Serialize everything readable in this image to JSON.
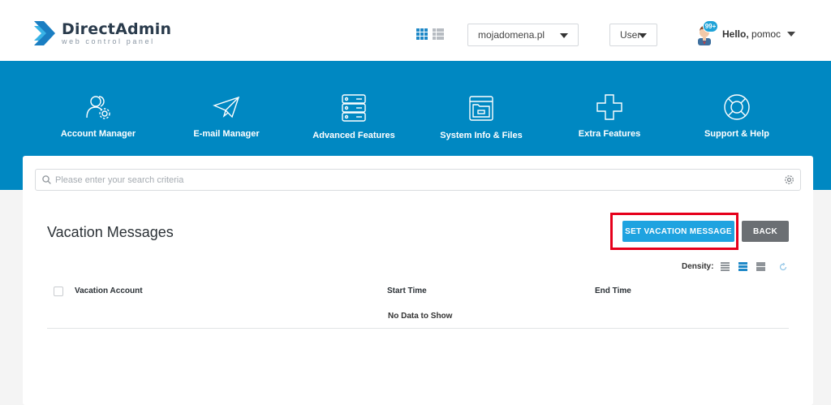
{
  "header": {
    "logo_name": "DirectAdmin",
    "logo_tagline": "web control panel",
    "domain_select": "mojadomena.pl",
    "role_select": "User",
    "notification_count": "99+",
    "greeting_prefix": "Hello,",
    "username": "pomoc",
    "brand_color": "#1e88c7"
  },
  "nav": {
    "items": [
      {
        "label": "Account Manager",
        "icon": "users-gear-icon"
      },
      {
        "label": "E-mail Manager",
        "icon": "paper-plane-icon"
      },
      {
        "label": "Advanced Features",
        "icon": "server-stack-icon"
      },
      {
        "label": "System Info & Files",
        "icon": "folder-icon"
      },
      {
        "label": "Extra Features",
        "icon": "plus-icon"
      },
      {
        "label": "Support & Help",
        "icon": "lifebuoy-icon"
      }
    ],
    "background": "#0088c2"
  },
  "search": {
    "placeholder": "Please enter your search criteria",
    "value": ""
  },
  "page": {
    "title": "Vacation Messages",
    "set_vacation_label": "SET VACATION MESSAGE",
    "back_label": "BACK",
    "highlight_color": "#e6001b"
  },
  "density": {
    "label": "Density:",
    "options": [
      "compact",
      "normal",
      "comfortable"
    ],
    "selected": "normal"
  },
  "table": {
    "columns": [
      "Vacation Account",
      "Start Time",
      "End Time"
    ],
    "rows": [],
    "empty_text": "No Data to Show"
  }
}
